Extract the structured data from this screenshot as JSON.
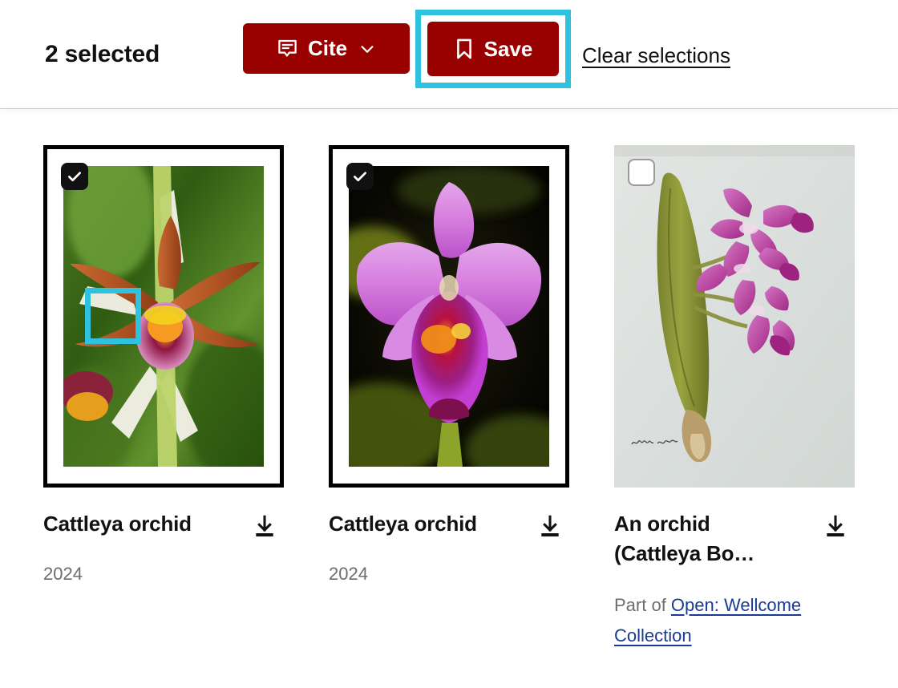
{
  "toolbar": {
    "selected_count_label": "2 selected",
    "cite_label": "Cite",
    "cite_icon": "cite-speech-bubble-icon",
    "cite_chevron_icon": "chevron-down-icon",
    "save_label": "Save",
    "save_icon": "bookmark-icon",
    "clear_label": "Clear selections",
    "button_color": "#990000",
    "highlight_color": "#2ec2de"
  },
  "results": [
    {
      "title": "Cattleya orchid",
      "date": "2024",
      "selected": true,
      "checkbox_icon": "checkbox-checked-icon",
      "download_icon": "download-icon",
      "highlighted": true,
      "part_of_prefix": "",
      "part_of_link": ""
    },
    {
      "title": "Cattleya orchid",
      "date": "2024",
      "selected": true,
      "checkbox_icon": "checkbox-checked-icon",
      "download_icon": "download-icon",
      "highlighted": false,
      "part_of_prefix": "",
      "part_of_link": ""
    },
    {
      "title": "An orchid (Cattleya Bo…",
      "date": "",
      "selected": false,
      "checkbox_icon": "checkbox-unchecked-icon",
      "download_icon": "download-icon",
      "highlighted": false,
      "part_of_prefix": "Part of ",
      "part_of_link": "Open: Wellcome Collection"
    }
  ]
}
